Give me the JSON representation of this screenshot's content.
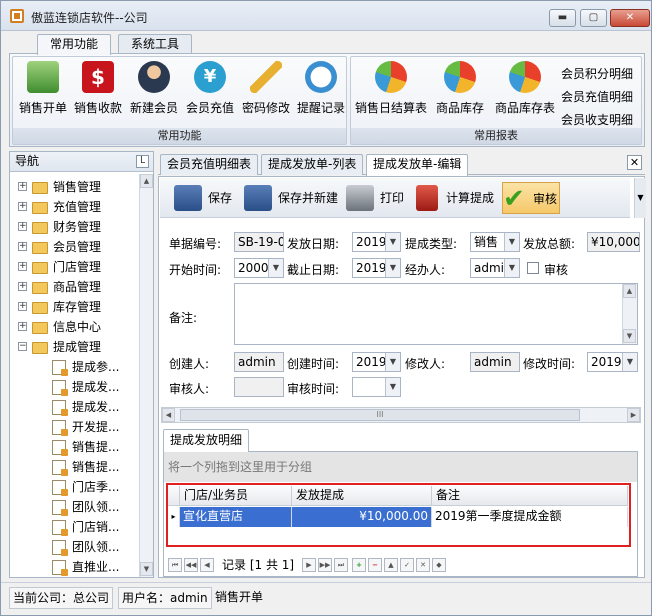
{
  "window": {
    "title": "傲蓝连锁店软件--公司",
    "min": "▬",
    "max": "▢",
    "close": "✕"
  },
  "ribbon_tabs": [
    "常用功能",
    "系统工具"
  ],
  "ribbon": {
    "group1": {
      "label": "常用功能",
      "buttons": [
        {
          "label": "销售开单",
          "icon": "sales-order-icon"
        },
        {
          "label": "销售收款",
          "icon": "dollar-icon"
        },
        {
          "label": "新建会员",
          "icon": "member-icon"
        },
        {
          "label": "会员充值",
          "icon": "yen-icon"
        },
        {
          "label": "密码修改",
          "icon": "pencil-icon"
        },
        {
          "label": "提醒记录",
          "icon": "clock-icon"
        }
      ]
    },
    "group2": {
      "label": "常用报表",
      "buttons": [
        {
          "label": "销售日结算表",
          "icon": "chart-icon"
        },
        {
          "label": "商品库存",
          "icon": "chart-icon"
        },
        {
          "label": "商品库存表",
          "icon": "chart-icon"
        }
      ],
      "small": [
        "会员积分明细",
        "会员充值明细",
        "会员收支明细"
      ]
    }
  },
  "nav": {
    "title": "导航",
    "pin": "㇄",
    "items": [
      "销售管理",
      "充值管理",
      "财务管理",
      "会员管理",
      "门店管理",
      "商品管理",
      "库存管理",
      "信息中心",
      "提成管理"
    ],
    "sub": [
      "提成参...",
      "提成发...",
      "提成发...",
      "开发提...",
      "销售提...",
      "销售提...",
      "门店季...",
      "团队领...",
      "门店销...",
      "团队领...",
      "直推业..."
    ]
  },
  "doc_tabs": [
    "会员充值明细表",
    "提成发放单-列表",
    "提成发放单-编辑"
  ],
  "doc_close": "✕",
  "toolbar": [
    "保存",
    "保存并新建",
    "打印",
    "计算提成",
    "审核"
  ],
  "form": {
    "doc_no_label": "单据编号:",
    "doc_no": "SB-19-0",
    "issue_date_label": "发放日期:",
    "issue_date": "2019",
    "type_label": "提成类型:",
    "type": "销售",
    "total_label": "发放总额:",
    "total": "¥10,000",
    "start_label": "开始时间:",
    "start": "2000",
    "end_label": "截止日期:",
    "end": "2019",
    "handler_label": "经办人:",
    "handler": "admi",
    "audit_check_label": "审核",
    "note_label": "备注:",
    "creator_label": "创建人:",
    "creator": "admin",
    "ctime_label": "创建时间:",
    "ctime": "2019",
    "modifier_label": "修改人:",
    "modifier": "admin",
    "mtime_label": "修改时间:",
    "mtime": "2019",
    "auditor_label": "审核人:",
    "auditor": "",
    "atime_label": "审核时间:",
    "atime": ""
  },
  "scroll_grip": "III",
  "detail": {
    "tab": "提成发放明细",
    "group_hint": "将一个列拖到这里用于分组",
    "columns": [
      "门店/业务员",
      "发放提成",
      "备注"
    ],
    "rows": [
      {
        "store": "宣化直营店",
        "amount": "¥10,000.00",
        "note": "2019第一季度提成金额"
      }
    ],
    "pager": "记录 [1 共 1]"
  },
  "status": {
    "company": "当前公司：总公司",
    "user": "用户名：admin",
    "action": "销售开单"
  },
  "colors": {
    "accent": "#3a6fd1",
    "highlight": "#e02020",
    "selected_row": "#3a6fd1"
  }
}
